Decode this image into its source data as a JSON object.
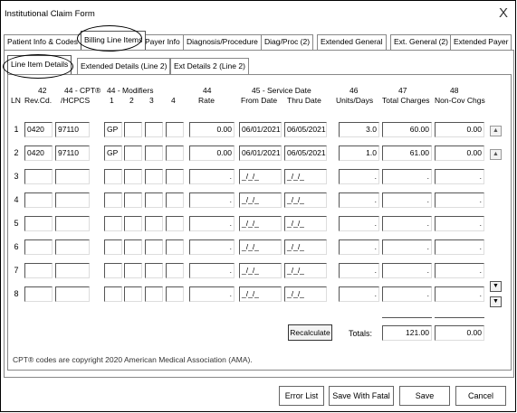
{
  "window": {
    "title": "Institutional Claim Form",
    "close_glyph": "X"
  },
  "tabs": [
    "Patient Info & Codes",
    "Billing Line Items",
    "Payer Info",
    "Diagnosis/Procedure",
    "Diag/Proc (2)",
    "Extended General",
    "Ext. General (2)",
    "Extended Payer"
  ],
  "subtabs": [
    "Line Item Details",
    "Extended Details (Line 2)",
    "Ext Details 2 (Line 2)"
  ],
  "headers": {
    "ln": "LN",
    "rev_num": "42",
    "rev": "Rev.Cd.",
    "cpt_num": "44 - CPT®",
    "cpt": "/HCPCS",
    "mod_title": "44 - Modifiers",
    "mod1": "1",
    "mod2": "2",
    "mod3": "3",
    "mod4": "4",
    "rate_num": "44",
    "rate": "Rate",
    "svc_title": "45 - Service Date",
    "from": "From Date",
    "thru": "Thru Date",
    "units_num": "46",
    "units": "Units/Days",
    "total_num": "47",
    "total": "Total Charges",
    "noncov_num": "48",
    "noncov": "Non-Cov Chgs"
  },
  "rows": [
    {
      "ln": "1",
      "rev": "0420",
      "cpt": "97110",
      "mod1": "GP",
      "mod2": "",
      "mod3": "",
      "mod4": "",
      "rate": "0.00",
      "from": "06/01/2021",
      "thru": "06/05/2021",
      "units": "3.0",
      "total": "60.00",
      "noncov": "0.00"
    },
    {
      "ln": "2",
      "rev": "0420",
      "cpt": "97110",
      "mod1": "GP",
      "mod2": "",
      "mod3": "",
      "mod4": "",
      "rate": "0.00",
      "from": "06/01/2021",
      "thru": "06/05/2021",
      "units": "1.0",
      "total": "61.00",
      "noncov": "0.00"
    },
    {
      "ln": "3",
      "rev": "",
      "cpt": "",
      "mod1": "",
      "mod2": "",
      "mod3": "",
      "mod4": "",
      "rate": ".",
      "from": "_/_/_",
      "thru": "_/_/_",
      "units": ".",
      "total": ".",
      "noncov": "."
    },
    {
      "ln": "4",
      "rev": "",
      "cpt": "",
      "mod1": "",
      "mod2": "",
      "mod3": "",
      "mod4": "",
      "rate": ".",
      "from": "_/_/_",
      "thru": "_/_/_",
      "units": ".",
      "total": ".",
      "noncov": "."
    },
    {
      "ln": "5",
      "rev": "",
      "cpt": "",
      "mod1": "",
      "mod2": "",
      "mod3": "",
      "mod4": "",
      "rate": ".",
      "from": "_/_/_",
      "thru": "_/_/_",
      "units": ".",
      "total": ".",
      "noncov": "."
    },
    {
      "ln": "6",
      "rev": "",
      "cpt": "",
      "mod1": "",
      "mod2": "",
      "mod3": "",
      "mod4": "",
      "rate": ".",
      "from": "_/_/_",
      "thru": "_/_/_",
      "units": ".",
      "total": ".",
      "noncov": "."
    },
    {
      "ln": "7",
      "rev": "",
      "cpt": "",
      "mod1": "",
      "mod2": "",
      "mod3": "",
      "mod4": "",
      "rate": ".",
      "from": "_/_/_",
      "thru": "_/_/_",
      "units": ".",
      "total": ".",
      "noncov": "."
    },
    {
      "ln": "8",
      "rev": "",
      "cpt": "",
      "mod1": "",
      "mod2": "",
      "mod3": "",
      "mod4": "",
      "rate": ".",
      "from": "_/_/_",
      "thru": "_/_/_",
      "units": ".",
      "total": ".",
      "noncov": "."
    }
  ],
  "recalculate_label": "Recalculate",
  "totals": {
    "label": "Totals:",
    "total_charges": "121.00",
    "noncov": "0.00"
  },
  "copyright": "CPT® codes are copyright 2020 American Medical Association (AMA).",
  "buttons": {
    "error_list": "Error List",
    "save_fatal": "Save With Fatal",
    "save": "Save",
    "cancel": "Cancel"
  },
  "icons": {
    "row_up": "up-arrow-icon",
    "scroll_down": "down-arrow-icon"
  }
}
